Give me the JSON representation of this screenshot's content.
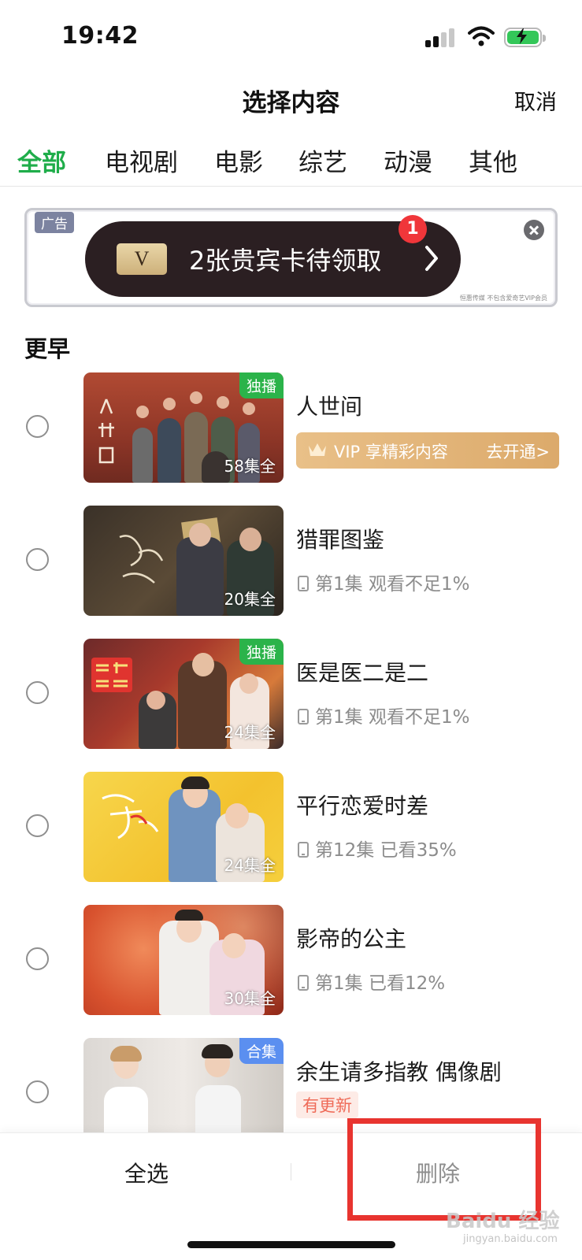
{
  "status_bar": {
    "time": "19:42",
    "signal_icon": "signal-icon",
    "wifi_icon": "wifi-icon",
    "battery_icon": "battery-charging-icon",
    "battery_color": "#34c759"
  },
  "header": {
    "title": "选择内容",
    "cancel_label": "取消"
  },
  "tabs": [
    {
      "label": "全部",
      "active": true
    },
    {
      "label": "电视剧",
      "active": false
    },
    {
      "label": "电影",
      "active": false
    },
    {
      "label": "综艺",
      "active": false
    },
    {
      "label": "动漫",
      "active": false
    },
    {
      "label": "其他",
      "active": false
    }
  ],
  "accent_color": "#1fad4a",
  "ad": {
    "label": "广告",
    "badge_letter": "V",
    "text": "2张贵宾卡待领取",
    "notification_count": "1",
    "footer": "恒惠传媒    不包含爱奇艺VIP会员"
  },
  "section_title": "更早",
  "items": [
    {
      "title": "人世间",
      "episodes": "58集全",
      "tag": "独播",
      "vip_text": "VIP 享精彩内容",
      "vip_cta": "去开通>"
    },
    {
      "title": "猎罪图鉴",
      "episodes": "20集全",
      "tag": "",
      "progress": "第1集 观看不足1%"
    },
    {
      "title": "医是医二是二",
      "episodes": "24集全",
      "tag": "独播",
      "progress": "第1集 观看不足1%"
    },
    {
      "title": "平行恋爱时差",
      "episodes": "24集全",
      "tag": "",
      "progress": "第12集 已看35%"
    },
    {
      "title": "影帝的公主",
      "episodes": "30集全",
      "tag": "",
      "progress": "第1集 已看12%"
    },
    {
      "title": "余生请多指教 偶像剧",
      "episodes": "",
      "tag": "合集",
      "update_badge": "有更新"
    }
  ],
  "bottom_bar": {
    "select_all_label": "全选",
    "delete_label": "删除"
  },
  "watermark": {
    "text": "Baidu 经验",
    "sub": "jingyan.baidu.com"
  }
}
